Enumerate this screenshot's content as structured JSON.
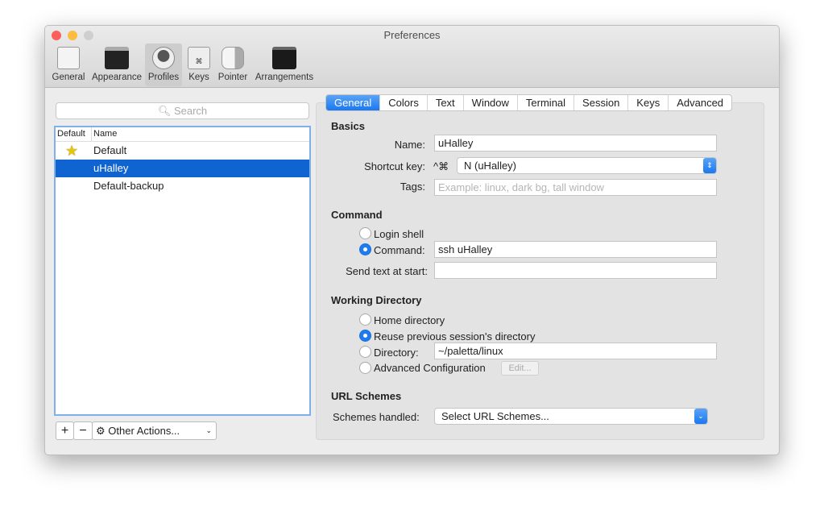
{
  "window": {
    "title": "Preferences"
  },
  "toolbar": [
    {
      "label": "General"
    },
    {
      "label": "Appearance"
    },
    {
      "label": "Profiles"
    },
    {
      "label": "Keys"
    },
    {
      "label": "Pointer"
    },
    {
      "label": "Arrangements"
    }
  ],
  "profiles": {
    "search_placeholder": "Search",
    "col_default": "Default",
    "col_name": "Name",
    "items": [
      {
        "name": "Default"
      },
      {
        "name": "uHalley"
      },
      {
        "name": "Default-backup"
      }
    ],
    "add": "+",
    "remove": "−",
    "other_actions": "Other Actions..."
  },
  "tabs": [
    {
      "label": "General"
    },
    {
      "label": "Colors"
    },
    {
      "label": "Text"
    },
    {
      "label": "Window"
    },
    {
      "label": "Terminal"
    },
    {
      "label": "Session"
    },
    {
      "label": "Keys"
    },
    {
      "label": "Advanced"
    }
  ],
  "basics": {
    "heading": "Basics",
    "name_label": "Name:",
    "name_value": "uHalley",
    "shortcut_label": "Shortcut key:",
    "shortcut_mod": "^⌘",
    "shortcut_value": "N (uHalley)",
    "tags_label": "Tags:",
    "tags_placeholder": "Example: linux, dark bg, tall window"
  },
  "command": {
    "heading": "Command",
    "login_shell": "Login shell",
    "command_label": "Command:",
    "command_value": "ssh uHalley",
    "send_text_label": "Send text at start:",
    "send_text_value": ""
  },
  "working_dir": {
    "heading": "Working Directory",
    "home": "Home directory",
    "reuse": "Reuse previous session's directory",
    "directory_label": "Directory:",
    "directory_value": "~/paletta/linux",
    "advanced": "Advanced Configuration",
    "edit": "Edit..."
  },
  "url": {
    "heading": "URL Schemes",
    "label": "Schemes handled:",
    "value": "Select URL Schemes..."
  }
}
